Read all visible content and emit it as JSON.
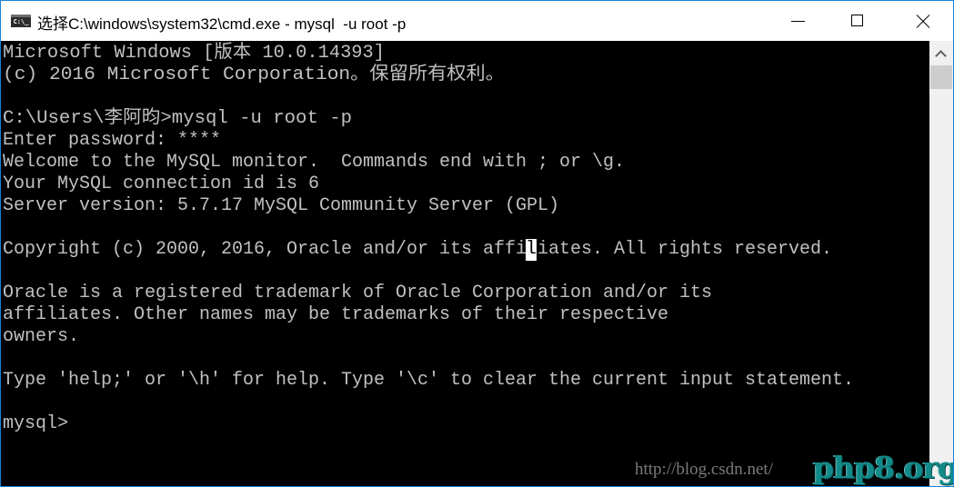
{
  "window": {
    "title": "选择C:\\windows\\system32\\cmd.exe - mysql  -u root -p",
    "app_icon_label": "C:\\_",
    "accent_color": "#1883d7",
    "controls": {
      "minimize": "minimize",
      "maximize": "maximize",
      "close": "close"
    }
  },
  "console": {
    "text_color": "#c0c0c0",
    "background": "#000000",
    "lines": [
      "Microsoft Windows [版本 10.0.14393]",
      "(c) 2016 Microsoft Corporation。保留所有权利。",
      "",
      "C:\\Users\\李阿昀>mysql -u root -p",
      "Enter password: ****",
      "Welcome to the MySQL monitor.  Commands end with ; or \\g.",
      "Your MySQL connection id is 6",
      "Server version: 5.7.17 MySQL Community Server (GPL)",
      "",
      "Copyright (c) 2000, 2016, Oracle and/or its affiliates. All rights reserved.",
      "",
      "Oracle is a registered trademark of Oracle Corporation and/or its",
      "affiliates. Other names may be trademarks of their respective",
      "owners.",
      "",
      "Type 'help;' or '\\h' for help. Type '\\c' to clear the current input statement.",
      "",
      "mysql>"
    ],
    "cursor_char": "l"
  },
  "watermark": {
    "url": "http://blog.csdn.net/",
    "logo": "php8.org"
  }
}
